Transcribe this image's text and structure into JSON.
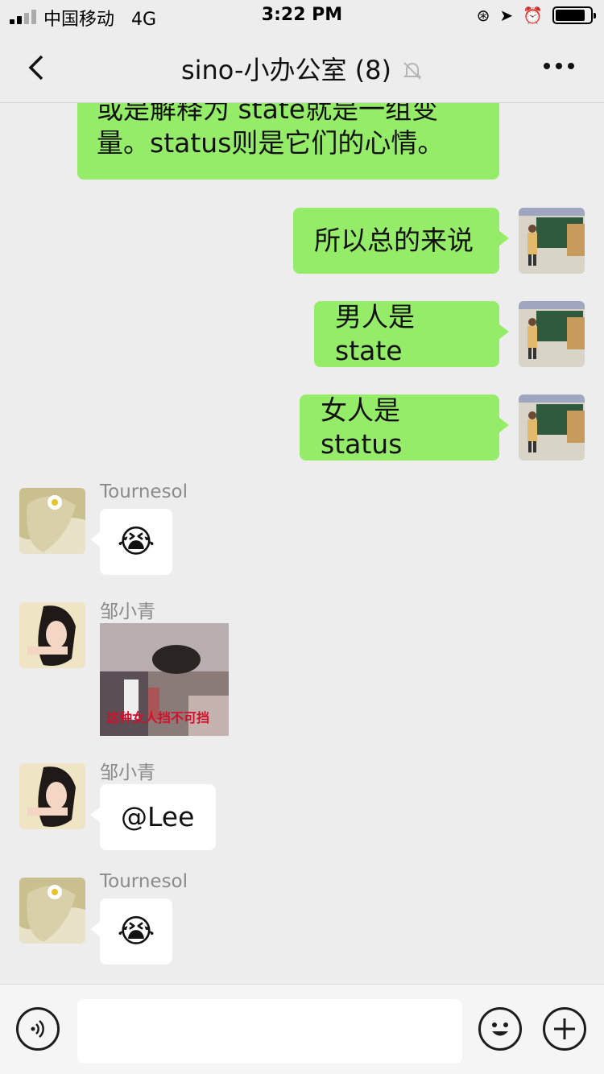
{
  "status_bar": {
    "carrier": "中国移动",
    "network": "4G",
    "time": "3:22 PM"
  },
  "header": {
    "title": "sino-小办公室 (8)"
  },
  "messages": [
    {
      "type": "text",
      "from": "self",
      "text": "或是解释为 state就是一组变量。status则是它们的心情。"
    },
    {
      "type": "text",
      "from": "self",
      "text": "所以总的来说"
    },
    {
      "type": "text",
      "from": "self",
      "text": "男人是state"
    },
    {
      "type": "text",
      "from": "self",
      "text": "女人是status"
    },
    {
      "type": "emoji",
      "from": "other",
      "sender": "Tournesol",
      "emoji": "😭"
    },
    {
      "type": "sticker",
      "from": "other",
      "sender": "邹小青",
      "caption": "这种女人挡不可挡"
    },
    {
      "type": "text",
      "from": "other",
      "sender": "邹小青",
      "text": "@Lee"
    },
    {
      "type": "emoji",
      "from": "other",
      "sender": "Tournesol",
      "emoji": "😭"
    }
  ],
  "input_bar": {
    "voice_icon": "voice-icon",
    "emoji_icon": "smiley-icon",
    "plus_icon": "plus-icon"
  },
  "colors": {
    "self_bubble": "#95ec69",
    "other_bubble": "#ffffff",
    "background": "#ededed"
  }
}
